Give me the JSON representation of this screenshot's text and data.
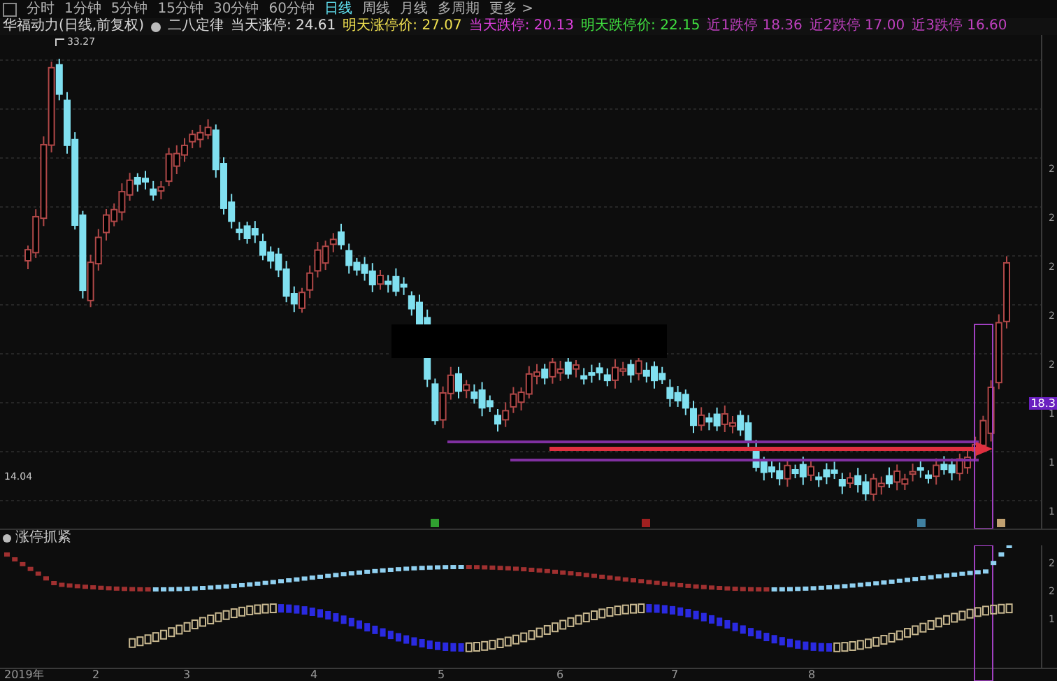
{
  "toolbar": {
    "tabs": [
      {
        "label": "分时",
        "selected": false
      },
      {
        "label": "1分钟",
        "selected": false
      },
      {
        "label": "5分钟",
        "selected": false
      },
      {
        "label": "15分钟",
        "selected": false
      },
      {
        "label": "30分钟",
        "selected": false
      },
      {
        "label": "60分钟",
        "selected": false
      },
      {
        "label": "日线",
        "selected": true
      },
      {
        "label": "周线",
        "selected": false
      },
      {
        "label": "月线",
        "selected": false
      },
      {
        "label": "多周期",
        "selected": false
      },
      {
        "label": "更多 >",
        "selected": false
      }
    ]
  },
  "info_bar": {
    "title": "华福动力(日线,前复权)",
    "indicator": "二八定律",
    "items": [
      {
        "label": "当天涨停:",
        "value": "24.61",
        "color": "#e0e0e0"
      },
      {
        "label": "明天涨停价:",
        "value": "27.07",
        "color": "#f0e050"
      },
      {
        "label": "当天跌停:",
        "value": "20.13",
        "color": "#e040e0"
      },
      {
        "label": "明天跌停价:",
        "value": "22.15",
        "color": "#40e040"
      },
      {
        "label": "近1跌停",
        "value": "18.36",
        "color": "#c040c0"
      },
      {
        "label": "近2跌停",
        "value": "17.00",
        "color": "#c040c0"
      },
      {
        "label": "近3跌停",
        "value": "16.60",
        "color": "#c040c0"
      }
    ]
  },
  "main_chart": {
    "high_label": "33.27",
    "low_label": "14.04",
    "price_tag": "18.3",
    "axis_labels": [
      "2",
      "2",
      "2",
      "2",
      "2",
      "1",
      "1",
      "1"
    ]
  },
  "lower_panel": {
    "title": "涨停抓紧",
    "axis_labels": [
      "2",
      "2",
      "1"
    ]
  },
  "date_axis": [
    "2019年",
    "2",
    "3",
    "4",
    "5",
    "6",
    "7",
    "8"
  ]
}
